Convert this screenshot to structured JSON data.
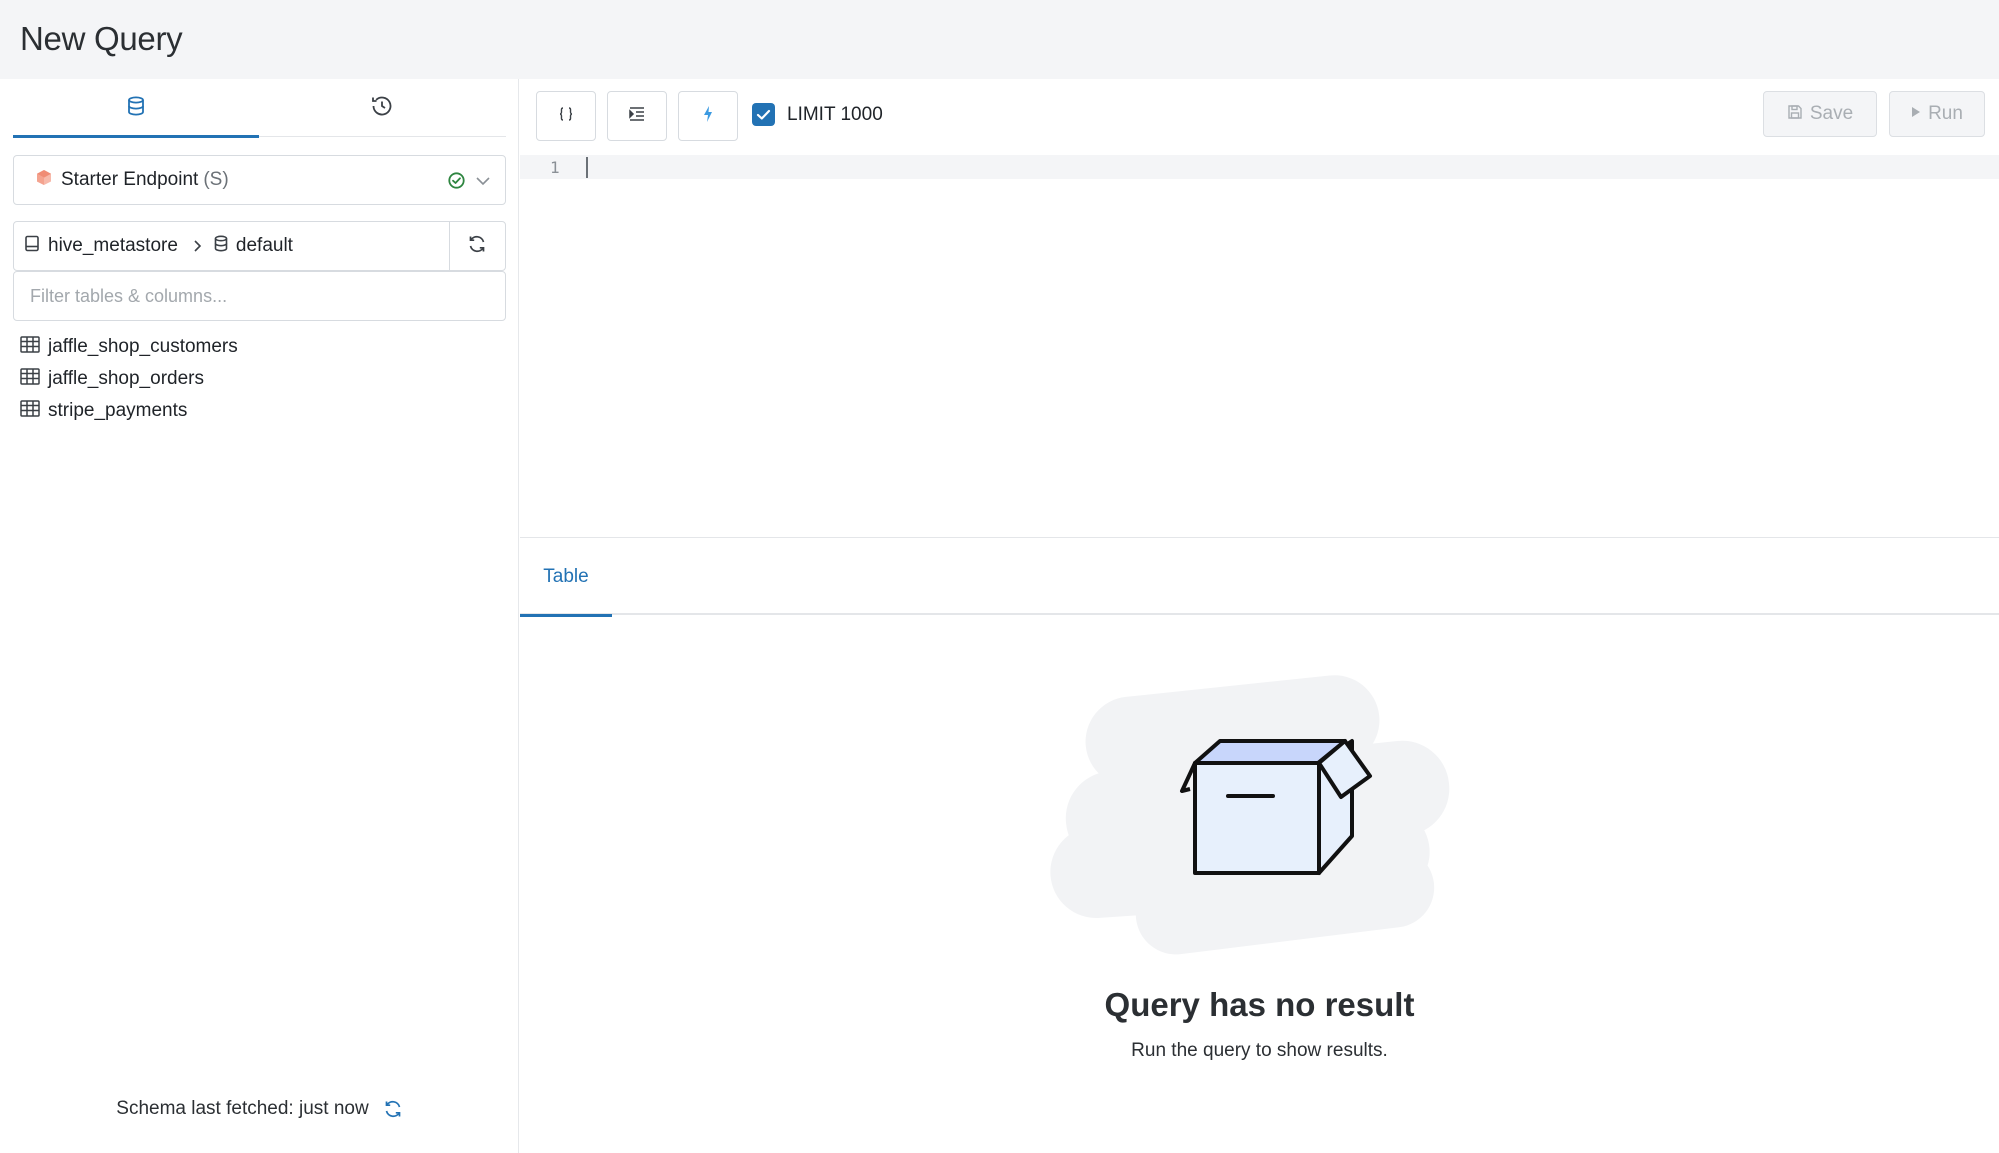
{
  "page": {
    "title": "New Query"
  },
  "sidebar": {
    "tabs": [
      {
        "icon": "database-icon",
        "active": true
      },
      {
        "icon": "history-icon",
        "active": false
      }
    ],
    "endpoint": {
      "name": "Starter Endpoint",
      "size": "(S)",
      "status": "running"
    },
    "catalog": {
      "catalog": "hive_metastore",
      "schema": "default"
    },
    "filter": {
      "placeholder": "Filter tables & columns...",
      "value": ""
    },
    "tables": [
      {
        "label": "jaffle_shop_customers"
      },
      {
        "label": "jaffle_shop_orders"
      },
      {
        "label": "stripe_payments"
      }
    ],
    "footer": {
      "text": "Schema last fetched: just now"
    }
  },
  "toolbar": {
    "tools": [
      "braces-icon",
      "indent-icon",
      "lightning-icon"
    ],
    "limit": {
      "checked": true,
      "label": "LIMIT 1000"
    },
    "save_label": "Save",
    "run_label": "Run"
  },
  "editor": {
    "line_number": "1",
    "content": ""
  },
  "results": {
    "tab_label": "Table",
    "empty_title": "Query has no result",
    "empty_subtitle": "Run the query to show results."
  },
  "colors": {
    "accent": "#2272b4",
    "success": "#2e8540",
    "endpoint_icon": "#f4a38f"
  }
}
